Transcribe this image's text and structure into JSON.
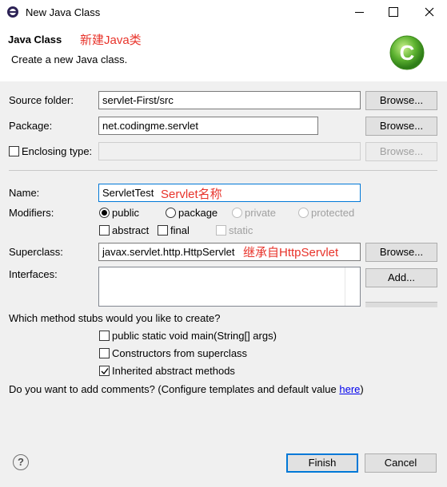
{
  "window": {
    "title": "New Java Class"
  },
  "header": {
    "title": "Java Class",
    "annotation": "新建Java类",
    "description": "Create a new Java class."
  },
  "form": {
    "source_folder": {
      "label": "Source folder:",
      "value": "servlet-First/src",
      "button": "Browse..."
    },
    "package": {
      "label": "Package:",
      "value": "net.codingme.servlet",
      "button": "Browse..."
    },
    "enclosing_type": {
      "label": "Enclosing type:",
      "value": "",
      "button": "Browse...",
      "checked": false
    },
    "name": {
      "label": "Name:",
      "value": "ServletTest",
      "annotation": "Servlet名称"
    },
    "modifiers": {
      "label": "Modifiers:",
      "options": [
        "public",
        "package",
        "private",
        "protected"
      ],
      "selected": "public",
      "abstract_label": "abstract",
      "final_label": "final",
      "static_label": "static"
    },
    "superclass": {
      "label": "Superclass:",
      "value": "javax.servlet.http.HttpServlet",
      "annotation": "继承自HttpServlet",
      "button": "Browse..."
    },
    "interfaces": {
      "label": "Interfaces:",
      "add_button": "Add..."
    }
  },
  "stubs": {
    "question": "Which method stubs would you like to create?",
    "main": {
      "label": "public static void main(String[] args)",
      "checked": false
    },
    "constructors": {
      "label": "Constructors from superclass",
      "checked": false
    },
    "inherited": {
      "label": "Inherited abstract methods",
      "checked": true
    }
  },
  "comments": {
    "question": "Do you want to add comments? (Configure templates and default value ",
    "link": "here",
    "suffix": ")"
  },
  "footer": {
    "help": "?",
    "finish": "Finish",
    "cancel": "Cancel"
  },
  "colors": {
    "annotation": "#e8332a",
    "accent": "#0078d7",
    "logo": "#5bb12f"
  }
}
